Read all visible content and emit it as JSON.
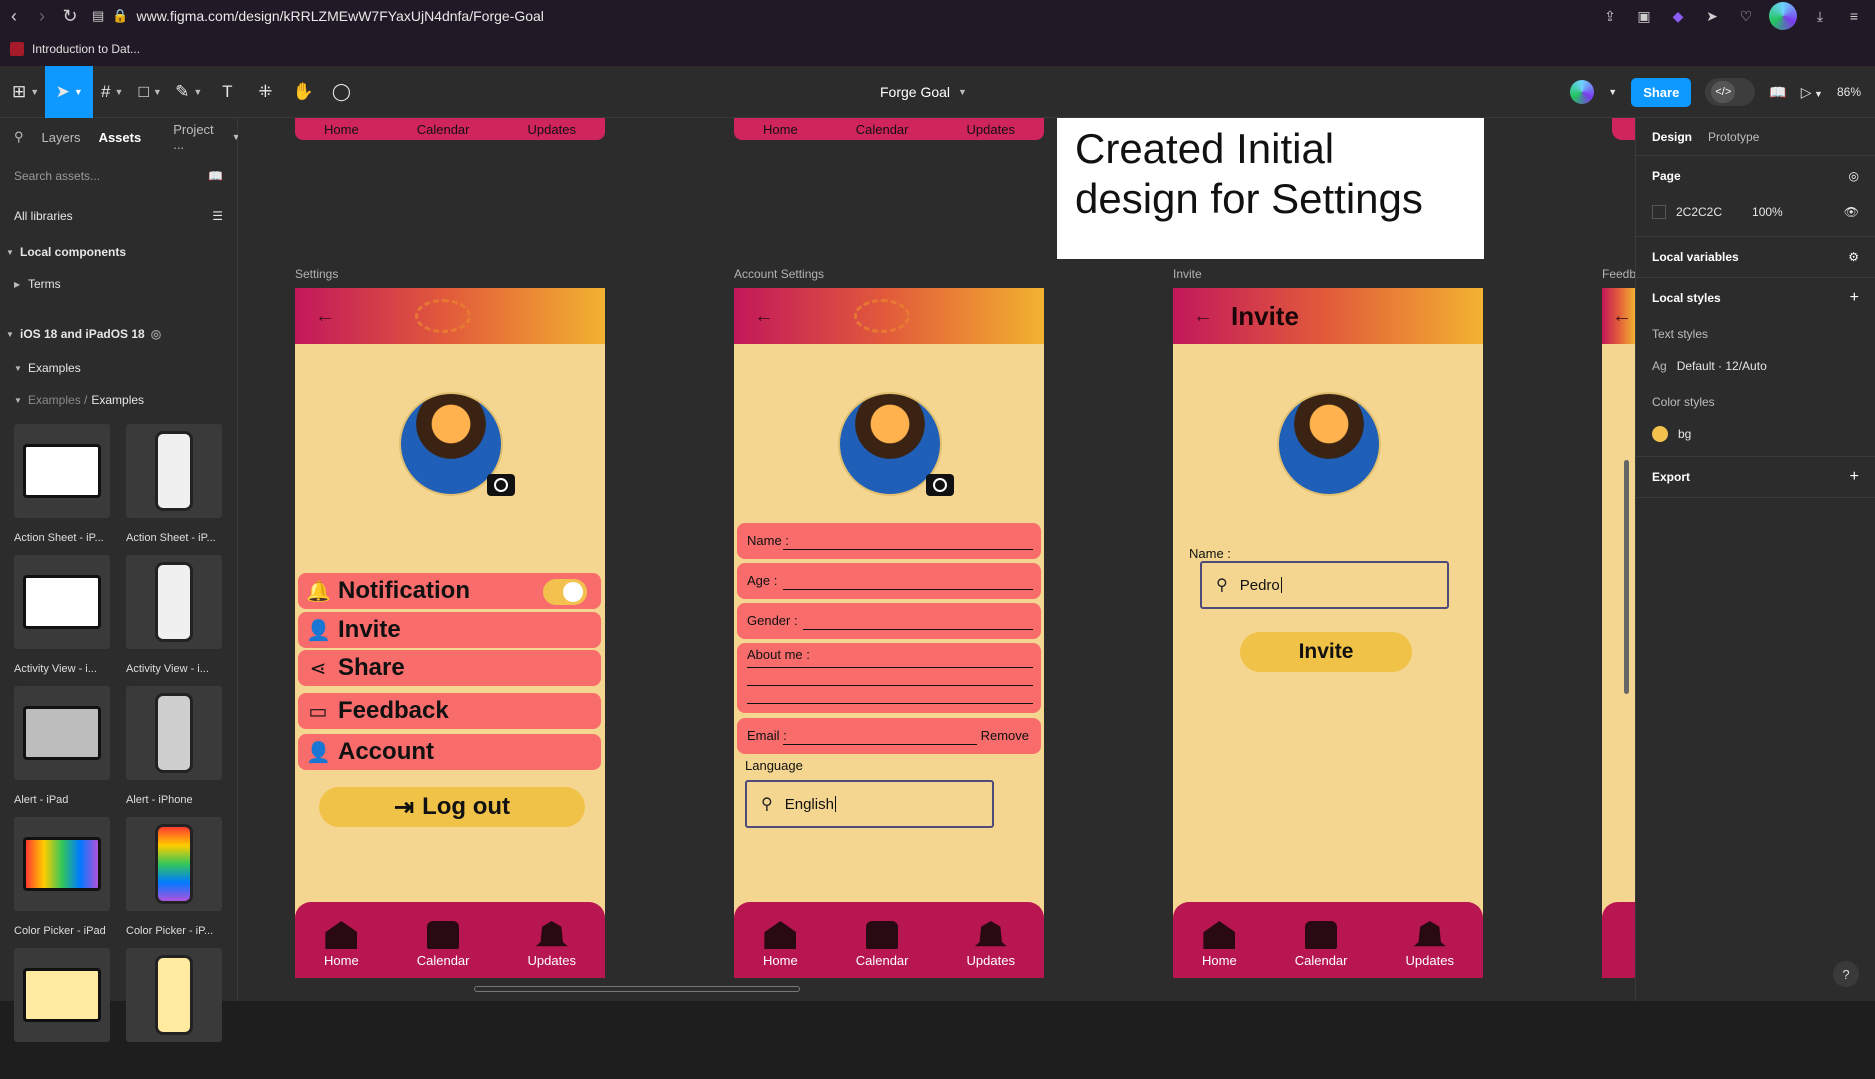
{
  "browser": {
    "url": "www.figma.com/design/kRRLZMEwW7FYaxUjN4dnfa/Forge-Goal",
    "bookmark": "Introduction to Dat..."
  },
  "toolbar": {
    "file_title": "Forge Goal",
    "share_label": "Share",
    "zoom": "86%"
  },
  "left_panel": {
    "tabs": [
      "Layers",
      "Assets",
      "Project ..."
    ],
    "search_placeholder": "Search assets...",
    "libraries": "All libraries",
    "local_components": "Local components",
    "terms": "Terms",
    "ios_library": "iOS 18 and iPadOS 18",
    "examples": "Examples",
    "examples_path_muted": "Examples /",
    "examples_path": "Examples",
    "thumbnails": [
      "Action Sheet - iP...",
      "Action Sheet - iP...",
      "Activity View - i...",
      "Activity View - i...",
      "Alert - iPad",
      "Alert - iPhone",
      "Color Picker - iPad",
      "Color Picker - iP..."
    ]
  },
  "canvas": {
    "labels": [
      "Settings",
      "Account Settings",
      "Invite",
      "Feedb"
    ],
    "top_nav": [
      "Home",
      "Calendar",
      "Updates"
    ],
    "note": "Created Initial design for Settings",
    "settings": {
      "rows": [
        "Notification",
        "Invite",
        "Share",
        "Feedback",
        "Account"
      ],
      "logout": "Log out"
    },
    "account": {
      "name": "Name :",
      "age": "Age :",
      "gender": "Gender :",
      "about": "About me :",
      "email": "Email :",
      "remove": "Remove",
      "language_label": "Language",
      "language_value": "English"
    },
    "invite": {
      "title": "Invite",
      "name_label": "Name :",
      "name_value": "Pedro",
      "button": "Invite"
    },
    "bottom_nav": [
      "Home",
      "Calendar",
      "Updates"
    ]
  },
  "right_panel": {
    "tabs": [
      "Design",
      "Prototype"
    ],
    "page_heading": "Page",
    "page_color": "2C2C2C",
    "page_opacity": "100%",
    "local_variables": "Local variables",
    "local_styles": "Local styles",
    "text_styles": "Text styles",
    "text_style_prefix": "Ag",
    "text_style_item": "Default · 12/Auto",
    "color_styles": "Color styles",
    "color_style_item": "bg",
    "export": "Export"
  }
}
